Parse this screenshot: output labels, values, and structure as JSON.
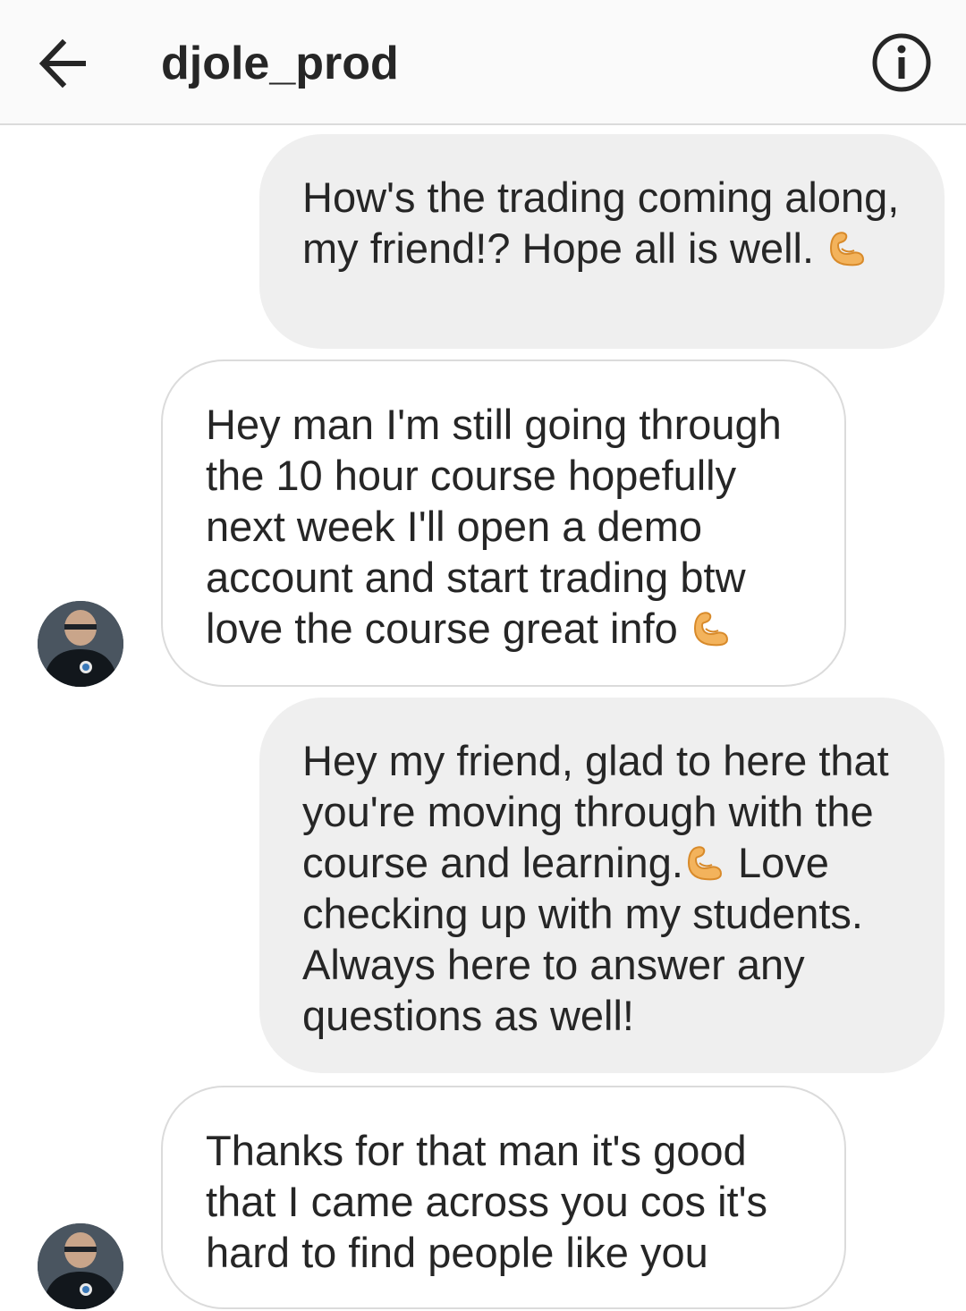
{
  "header": {
    "title": "djole_prod",
    "back_icon": "arrow-left-icon",
    "info_icon": "info-icon"
  },
  "colors": {
    "sent_bubble": "#efefef",
    "received_border": "#dbdbdb",
    "header_bg": "#fafafa",
    "text": "#262626"
  },
  "messages": [
    {
      "direction": "sent",
      "text_before": "How's the trading coming along, my friend!? Hope all is well. ",
      "emoji": "flexed-biceps-icon",
      "text_after": ""
    },
    {
      "direction": "received",
      "text_before": "Hey man I'm still going through the 10 hour course hopefully next week I'll open a demo account and start trading btw love the course great info ",
      "emoji": "flexed-biceps-icon",
      "text_after": ""
    },
    {
      "direction": "sent",
      "text_before": "Hey my friend, glad to here that you're moving through with the course and learning.",
      "emoji": "flexed-biceps-icon",
      "text_after": " Love checking up with my students. Always here to answer any questions as well!"
    },
    {
      "direction": "received",
      "text_before": "Thanks for that man it's good that I came across you cos it's hard to find people like you",
      "emoji": "",
      "text_after": ""
    }
  ]
}
